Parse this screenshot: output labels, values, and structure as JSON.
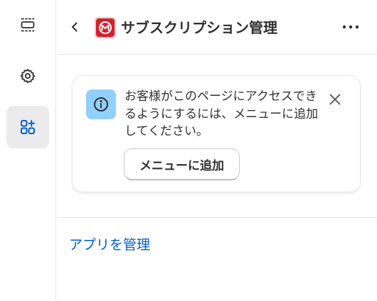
{
  "app": {
    "title": "サブスクリプション管理",
    "icon": "subscription-app-icon",
    "brand_color": "#d3202d"
  },
  "rail": {
    "items": [
      {
        "icon": "layout-sections-icon",
        "active": false
      },
      {
        "icon": "settings-gear-icon",
        "active": false
      },
      {
        "icon": "apps-add-icon",
        "active": true
      }
    ],
    "accent_color": "#005bd3"
  },
  "banner": {
    "message": "お客様がこのページにアクセスできるようにするには、メニューに追加してください。",
    "button_label": "メニューに追加",
    "info_color": "#91d0ff"
  },
  "footer": {
    "manage_link": "アプリを管理",
    "link_color": "#005bd3"
  }
}
